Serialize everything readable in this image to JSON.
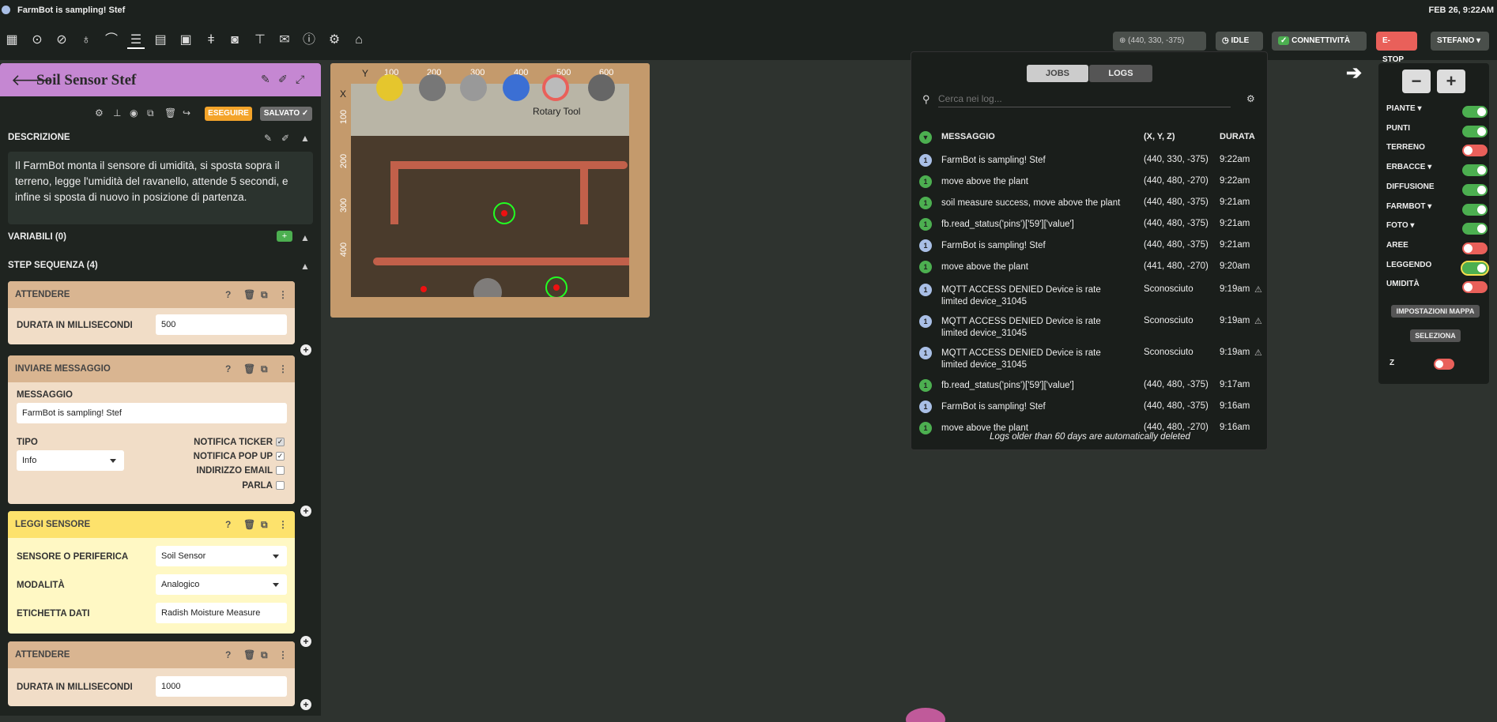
{
  "window": {
    "title": "FarmBot is sampling! Stef",
    "datetime": "FEB 26, 9:22AM"
  },
  "status": {
    "coords": "(440, 330, -375)",
    "idle": "IDLE",
    "connectivity": "CONNETTIVITÀ",
    "estop": "E-STOP",
    "user": "STEFANO"
  },
  "sequence": {
    "title": "Soil Sensor Stef",
    "run_label": "ESEGUIRE",
    "saved_label": "SALVATO ✓",
    "description_label": "DESCRIZIONE",
    "description": "Il FarmBot monta il sensore di umidità, si sposta sopra il terreno, legge l'umidità del ravanello, attende 5 secondi, e infine si sposta di nuovo in posizione di partenza.",
    "variables_label": "VARIABILI (0)",
    "steps_label": "STEP SEQUENZA (4)"
  },
  "steps": {
    "wait1": {
      "title": "ATTENDERE",
      "field_label": "DURATA IN MILLISECONDI",
      "value": "500"
    },
    "message": {
      "title": "INVIARE MESSAGGIO",
      "message_label": "MESSAGGIO",
      "message_value": "FarmBot is sampling! Stef",
      "type_label": "TIPO",
      "type_value": "Info",
      "ticker": "NOTIFICA TICKER",
      "popup": "NOTIFICA POP UP",
      "email": "INDIRIZZO EMAIL",
      "speak": "PARLA"
    },
    "read": {
      "title": "LEGGI SENSORE",
      "sensor_label": "SENSORE O PERIFERICA",
      "sensor_value": "Soil Sensor",
      "mode_label": "MODALITÀ",
      "mode_value": "Analogico",
      "tag_label": "ETICHETTA DATI",
      "tag_value": "Radish Moisture Measure"
    },
    "wait2": {
      "title": "ATTENDERE",
      "field_label": "DURATA IN MILLISECONDI",
      "value": "1000"
    }
  },
  "map": {
    "x_label": "X",
    "y_label": "Y",
    "x_ticks": [
      "100",
      "200",
      "300",
      "400",
      "500",
      "600"
    ],
    "y_ticks": [
      "100",
      "200",
      "300",
      "400"
    ],
    "tool_label": "Rotary Tool"
  },
  "logs": {
    "tab_jobs": "JOBS",
    "tab_logs": "LOGS",
    "search_placeholder": "Cerca nei log...",
    "col_message": "MESSAGGIO",
    "col_xyz": "(X, Y, Z)",
    "col_time": "DURATA",
    "rows": [
      {
        "level": "1",
        "msg": "FarmBot is sampling! Stef",
        "xyz": "(440, 330, -375)",
        "time": "9:22am",
        "kind": "info"
      },
      {
        "level": "1",
        "msg": "move above the plant",
        "xyz": "(440, 480, -270)",
        "time": "9:22am",
        "kind": "success"
      },
      {
        "level": "1",
        "msg": "soil measure success, move above the plant",
        "xyz": "(440, 480, -375)",
        "time": "9:21am",
        "kind": "success"
      },
      {
        "level": "1",
        "msg": "fb.read_status('pins')['59']['value']",
        "xyz": "(440, 480, -375)",
        "time": "9:21am",
        "kind": "success"
      },
      {
        "level": "1",
        "msg": "FarmBot is sampling! Stef",
        "xyz": "(440, 480, -375)",
        "time": "9:21am",
        "kind": "info"
      },
      {
        "level": "1",
        "msg": "move above the plant",
        "xyz": "(441, 480, -270)",
        "time": "9:20am",
        "kind": "success"
      },
      {
        "level": "1",
        "msg": "MQTT ACCESS DENIED Device is rate limited device_31045",
        "xyz": "Sconosciuto",
        "time": "9:19am",
        "kind": "info"
      },
      {
        "level": "1",
        "msg": "MQTT ACCESS DENIED Device is rate limited device_31045",
        "xyz": "Sconosciuto",
        "time": "9:19am",
        "kind": "info"
      },
      {
        "level": "1",
        "msg": "MQTT ACCESS DENIED Device is rate limited device_31045",
        "xyz": "Sconosciuto",
        "time": "9:19am",
        "kind": "info"
      },
      {
        "level": "1",
        "msg": "fb.read_status('pins')['59']['value']",
        "xyz": "(440, 480, -375)",
        "time": "9:17am",
        "kind": "success"
      },
      {
        "level": "1",
        "msg": "FarmBot is sampling! Stef",
        "xyz": "(440, 480, -375)",
        "time": "9:16am",
        "kind": "info"
      },
      {
        "level": "1",
        "msg": "move above the plant",
        "xyz": "(440, 480, -270)",
        "time": "9:16am",
        "kind": "success"
      }
    ],
    "footer": "Logs older than 60 days are automatically deleted"
  },
  "layers": {
    "items": [
      "PIANTE",
      "PUNTI",
      "TERRENO",
      "ERBACCE",
      "DIFFUSIONE",
      "FARMBOT",
      "FOTO",
      "AREE",
      "LEGGENDO",
      "UMIDITÀ"
    ],
    "states": [
      true,
      true,
      false,
      true,
      true,
      true,
      true,
      false,
      true,
      false
    ],
    "map_settings": "IMPOSTAZIONI MAPPA",
    "select": "SELEZIONA",
    "z_label": "Z"
  },
  "colors": {
    "green": "#4caf50",
    "red": "#e9605a",
    "purple": "#c587d2",
    "orange": "#f4a42a",
    "info_badge": "#a9bfe6"
  }
}
